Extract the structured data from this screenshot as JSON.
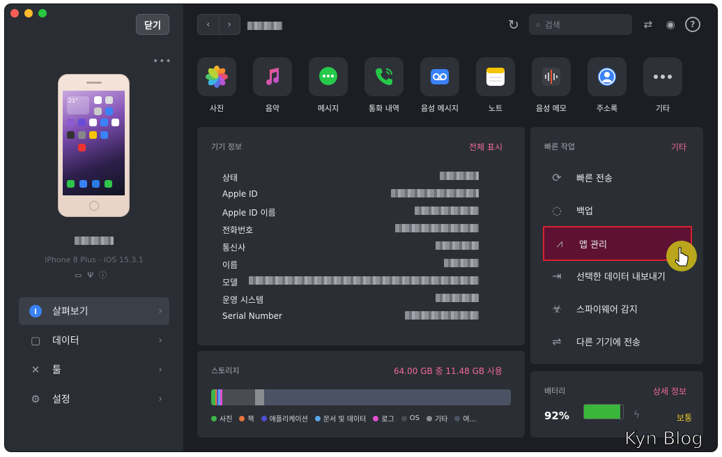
{
  "header": {
    "close_label": "닫기",
    "search_placeholder": "검색"
  },
  "device": {
    "model_line": "iPhone 8 Plus - iOS 15.3.1",
    "menu_dots": "•••",
    "phone_time": "21°"
  },
  "sidebar": {
    "items": [
      {
        "label": "살펴보기",
        "icon": "info-icon",
        "active": true
      },
      {
        "label": "데이터",
        "icon": "square-icon",
        "active": false
      },
      {
        "label": "툴",
        "icon": "tools-icon",
        "active": false
      },
      {
        "label": "설정",
        "icon": "gear-icon",
        "active": false
      }
    ]
  },
  "categories": [
    {
      "label": "사진",
      "icon": "photos-icon"
    },
    {
      "label": "음악",
      "icon": "music-icon"
    },
    {
      "label": "메시지",
      "icon": "messages-icon"
    },
    {
      "label": "통화 내역",
      "icon": "phone-icon"
    },
    {
      "label": "음성 메시지",
      "icon": "voicemail-icon"
    },
    {
      "label": "노트",
      "icon": "notes-icon"
    },
    {
      "label": "음성 메모",
      "icon": "voice-memo-icon"
    },
    {
      "label": "주소록",
      "icon": "contacts-icon"
    },
    {
      "label": "기타",
      "icon": "more-icon"
    }
  ],
  "device_info": {
    "title": "기기 정보",
    "link": "전체 표시",
    "rows": [
      "상태",
      "Apple ID",
      "Apple ID 이름",
      "전화번호",
      "통신사",
      "이름",
      "모델",
      "운영 시스템",
      "Serial Number"
    ]
  },
  "quick_actions": {
    "title": "빠른 작업",
    "link": "기타",
    "items": [
      {
        "label": "빠른 전송",
        "icon": "quick-transfer-icon"
      },
      {
        "label": "백업",
        "icon": "backup-icon"
      },
      {
        "label": "앱 관리",
        "icon": "app-store-icon",
        "highlighted": true
      },
      {
        "label": "선택한 데이터 내보내기",
        "icon": "export-icon"
      },
      {
        "label": "스파이웨어 감지",
        "icon": "biohazard-icon"
      },
      {
        "label": "다른 기기에 전송",
        "icon": "device-transfer-icon"
      }
    ]
  },
  "storage": {
    "title": "스토리지",
    "summary": "64.00 GB 중 11.48 GB 사용",
    "legend": [
      {
        "label": "사진",
        "color": "#3fb54a"
      },
      {
        "label": "책",
        "color": "#e8743b"
      },
      {
        "label": "애플리케이션",
        "color": "#4d4fd6"
      },
      {
        "label": "문서 및 데이터",
        "color": "#5aa6e8"
      },
      {
        "label": "로그",
        "color": "#e04fd0"
      },
      {
        "label": "OS",
        "color": "#4a4c52"
      },
      {
        "label": "기타",
        "color": "#8a8c90"
      },
      {
        "label": "여…",
        "color": "#4b5263"
      }
    ]
  },
  "battery": {
    "title": "배터리",
    "link": "상세 정보",
    "percent": "92%",
    "percent_value": 92,
    "status": "보통"
  },
  "watermark": "Kyn Blog"
}
